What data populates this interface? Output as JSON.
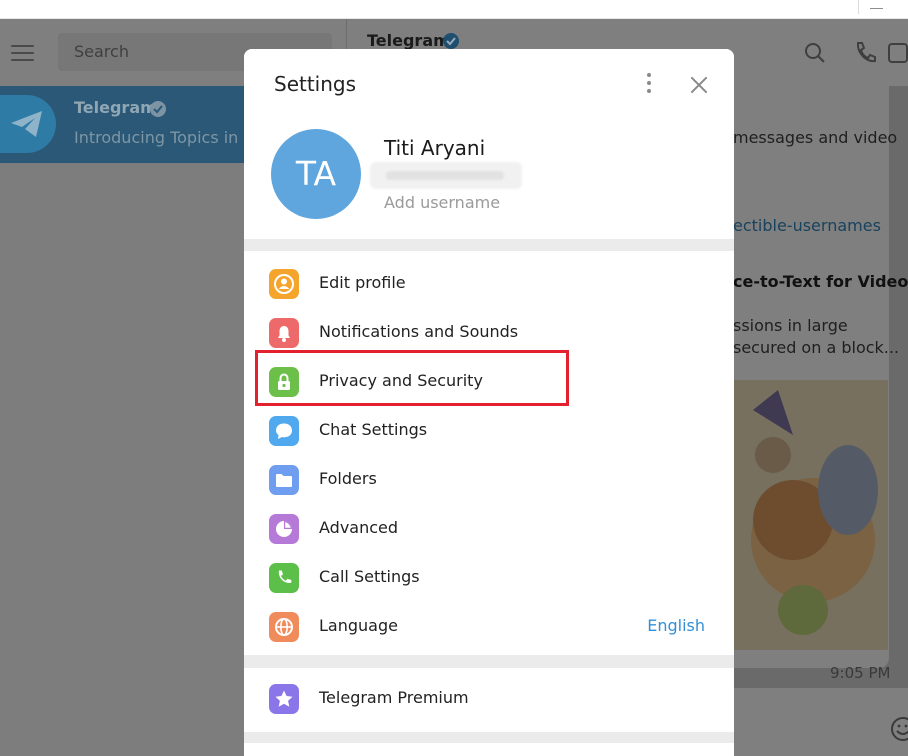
{
  "left_panel": {
    "search_placeholder": "Search",
    "chats": [
      {
        "name": "Telegram",
        "preview": "Introducing Topics in Groups"
      }
    ]
  },
  "chat_header": {
    "title": "Telegram"
  },
  "message": {
    "lines": [
      "messages and video",
      "ectible-usernames",
      "ce-to-Text for Video",
      "ssions in large",
      "secured on a block..."
    ],
    "time": "9:05 PM"
  },
  "settings": {
    "title": "Settings",
    "profile": {
      "initials": "TA",
      "name": "Titi Aryani",
      "username_placeholder": "Add username"
    },
    "menu": [
      {
        "label": "Edit profile",
        "icon": "person-icon",
        "color": "#f5a42c"
      },
      {
        "label": "Notifications and Sounds",
        "icon": "bell-icon",
        "color": "#ee6a6a"
      },
      {
        "label": "Privacy and Security",
        "icon": "lock-icon",
        "color": "#6cc04a",
        "highlighted": true
      },
      {
        "label": "Chat Settings",
        "icon": "chat-bubble-icon",
        "color": "#50a9ef"
      },
      {
        "label": "Folders",
        "icon": "folder-icon",
        "color": "#6f9df0"
      },
      {
        "label": "Advanced",
        "icon": "pie-chart-icon",
        "color": "#b57ad8"
      },
      {
        "label": "Call Settings",
        "icon": "phone-icon",
        "color": "#5cbf4a"
      },
      {
        "label": "Language",
        "icon": "globe-icon",
        "color": "#f08b5c",
        "value": "English"
      }
    ],
    "premium": {
      "label": "Telegram Premium",
      "icon": "star-icon",
      "color": "#8a76e8"
    }
  },
  "colors": {
    "accent": "#3390d6",
    "highlight_border": "#e3202d",
    "avatar": "#5fa6de"
  }
}
